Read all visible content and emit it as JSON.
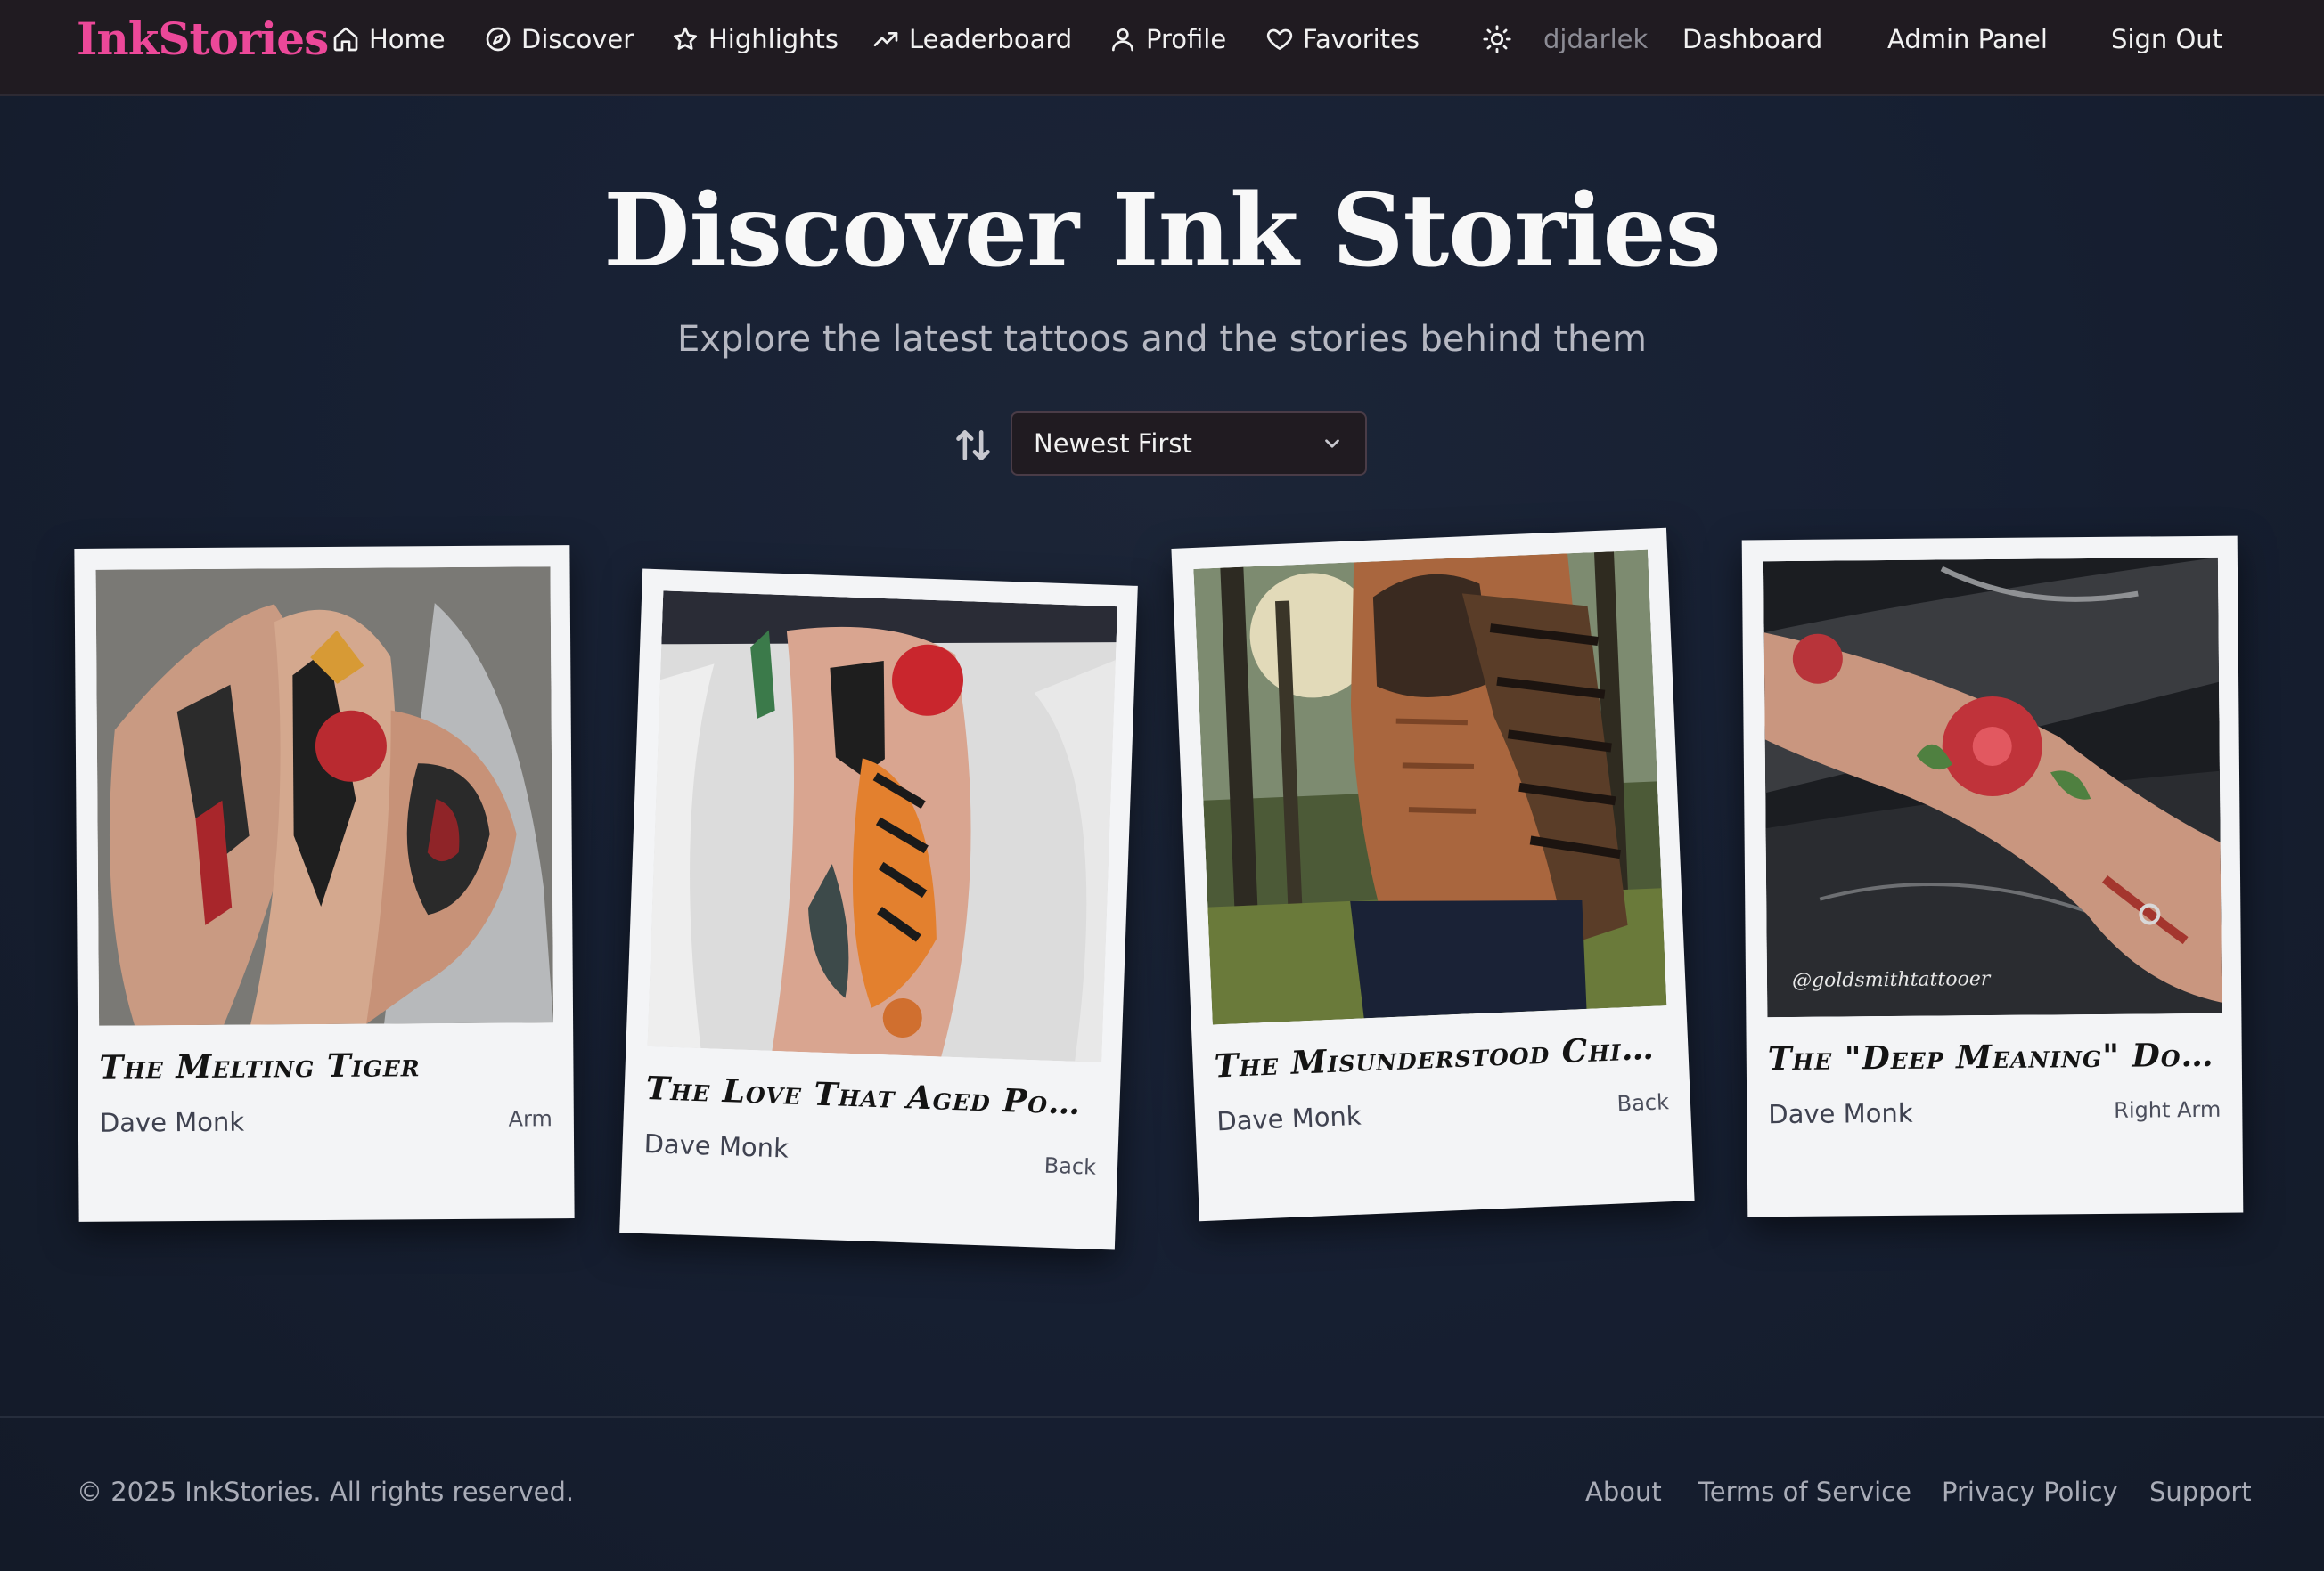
{
  "brand": {
    "name": "InkStories",
    "color": "#ec4899"
  },
  "nav": {
    "items": [
      {
        "label": "Home",
        "icon": "home-icon"
      },
      {
        "label": "Discover",
        "icon": "compass-icon"
      },
      {
        "label": "Highlights",
        "icon": "star-icon"
      },
      {
        "label": "Leaderboard",
        "icon": "trending-up-icon"
      },
      {
        "label": "Profile",
        "icon": "user-icon"
      },
      {
        "label": "Favorites",
        "icon": "heart-icon"
      }
    ],
    "theme_toggle_icon": "sun-icon",
    "username": "djdarlek",
    "dashboard_label": "Dashboard",
    "admin_label": "Admin Panel",
    "signout_label": "Sign Out"
  },
  "hero": {
    "title": "Discover Ink Stories",
    "subtitle": "Explore the latest tattoos and the stories behind them"
  },
  "sort": {
    "icon": "sort-arrows-icon",
    "selected": "Newest First"
  },
  "cards": [
    {
      "title": "The Melting Tiger",
      "artist": "Dave Monk",
      "placement": "Arm"
    },
    {
      "title": "The Love That Aged Poorly",
      "artist": "Dave Monk",
      "placement": "Back"
    },
    {
      "title": "The Misunderstood Chinese...",
      "artist": "Dave Monk",
      "placement": "Back"
    },
    {
      "title": "The \"Deep Meaning\" Dolphin",
      "artist": "Dave Monk",
      "placement": "Right Arm",
      "watermark": "@goldsmithtattooer"
    }
  ],
  "footer": {
    "copyright": "© 2025 InkStories. All rights reserved.",
    "links": [
      "About",
      "Terms of Service",
      "Privacy Policy",
      "Support"
    ]
  }
}
